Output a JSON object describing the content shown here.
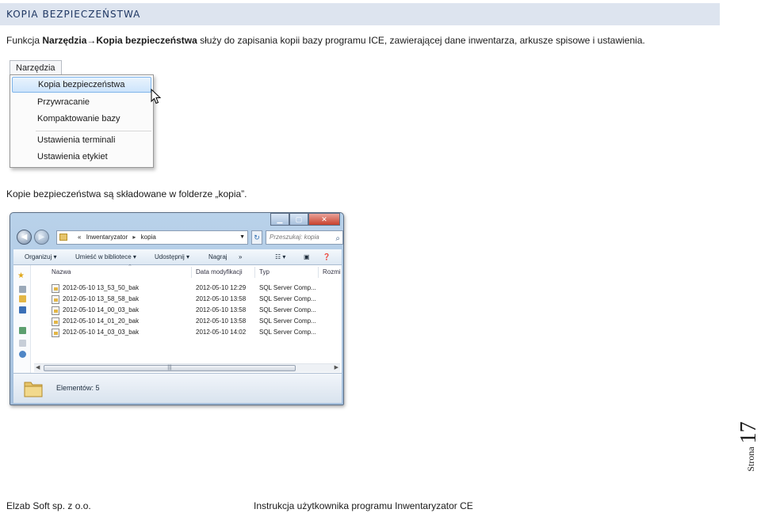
{
  "section": {
    "title": "KOPIA BEZPIECZEŃSTWA"
  },
  "intro": {
    "prefix": "Funkcja ",
    "path_bold": "Narzędzia→Kopia bezpieczeństwa",
    "suffix": " służy do zapisania kopii bazy programu ICE, zawierającej dane inwentarza, arkusze spisowe i ustawienia."
  },
  "menu": {
    "tab_label": "Narzędzia",
    "items": [
      {
        "label": "Kopia bezpieczeństwa",
        "highlighted": true
      },
      {
        "label": "Przywracanie"
      },
      {
        "label": "Kompaktowanie bazy"
      },
      {
        "label": "Ustawienia terminali"
      },
      {
        "label": "Ustawienia etykiet"
      }
    ]
  },
  "caption": "Kopie bezpieczeństwa są składowane w folderze „kopia”.",
  "explorer": {
    "breadcrumb_prefix": "«",
    "breadcrumb": [
      "Inwentaryzator",
      "kopia"
    ],
    "search_placeholder": "Przeszukaj: kopia",
    "toolbar": {
      "organize": "Organizuj ▾",
      "library": "Umieść w bibliotece ▾",
      "share": "Udostępnij ▾",
      "burn": "Nagraj",
      "more": "»"
    },
    "columns": {
      "name": "Nazwa",
      "date": "Data modyfikacji",
      "type": "Typ",
      "size": "Rozmi"
    },
    "files": [
      {
        "name": "2012-05-10 13_53_50_bak",
        "date": "2012-05-10 12:29",
        "type": "SQL Server Comp..."
      },
      {
        "name": "2012-05-10 13_58_58_bak",
        "date": "2012-05-10 13:58",
        "type": "SQL Server Comp..."
      },
      {
        "name": "2012-05-10 14_00_03_bak",
        "date": "2012-05-10 13:58",
        "type": "SQL Server Comp..."
      },
      {
        "name": "2012-05-10 14_01_20_bak",
        "date": "2012-05-10 13:58",
        "type": "SQL Server Comp..."
      },
      {
        "name": "2012-05-10 14_03_03_bak",
        "date": "2012-05-10 14:02",
        "type": "SQL Server Comp..."
      }
    ],
    "status": "Elementów: 5"
  },
  "page": {
    "label": "Strona",
    "number": "17"
  },
  "footer": {
    "company": "Elzab Soft sp. z o.o.",
    "doc_title": "Instrukcja użytkownika programu Inwentaryzator CE"
  }
}
